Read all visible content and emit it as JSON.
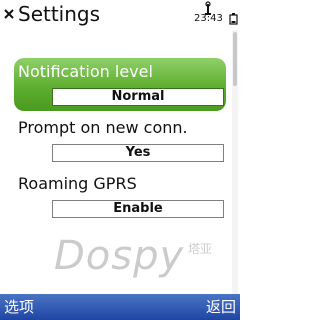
{
  "header": {
    "title": "Settings",
    "time": "23:43"
  },
  "settings": [
    {
      "label": "Notification level",
      "value": "Normal",
      "selected": true
    },
    {
      "label": "Prompt on new conn.",
      "value": "Yes",
      "selected": false
    },
    {
      "label": "Roaming GPRS",
      "value": "Enable",
      "selected": false
    }
  ],
  "watermark": {
    "text": "Dospy",
    "subtext": "塔亚"
  },
  "softkeys": {
    "left": "选项",
    "right": "返回"
  },
  "colors": {
    "selected_gradient_top": "#8fd06a",
    "selected_gradient_bottom": "#4b9a22",
    "softkey_bar": "#2a55b4"
  },
  "icons": [
    "close-icon",
    "signal-icon",
    "battery-icon"
  ]
}
